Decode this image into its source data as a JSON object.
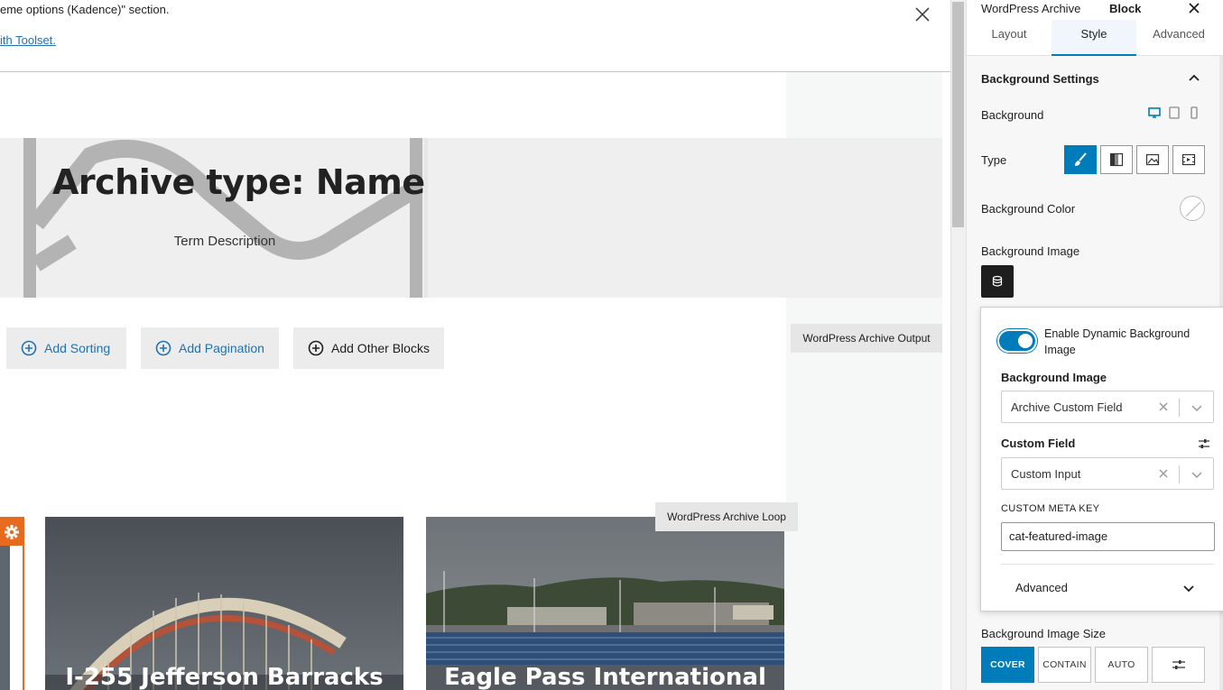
{
  "notice": {
    "text": "eme options (Kadence)\" section.",
    "link": "ith Toolset."
  },
  "hero": {
    "title": "Archive type: Name",
    "description": "Term Description"
  },
  "editor_buttons": {
    "add_sorting": "Add Sorting",
    "add_pagination": "Add Pagination",
    "add_other": "Add Other Blocks"
  },
  "block_labels": {
    "output": "WordPress Archive Output",
    "loop": "WordPress Archive Loop"
  },
  "cards": [
    {
      "title": "I-255 Jefferson Barracks"
    },
    {
      "title": "Eagle Pass International"
    }
  ],
  "sidebar": {
    "tab_document": "WordPress Archive",
    "tab_block": "Block",
    "subtabs": [
      "Layout",
      "Style",
      "Advanced"
    ],
    "active_subtab": "Style",
    "section_title": "Background Settings",
    "background_label": "Background",
    "type_label": "Type",
    "bg_color_label": "Background Color",
    "bg_image_label": "Background Image",
    "popover": {
      "toggle_label": "Enable Dynamic Background Image",
      "toggle_on": true,
      "bg_image_heading": "Background Image",
      "bg_image_value": "Archive Custom Field",
      "custom_field_heading": "Custom Field",
      "custom_field_value": "Custom Input",
      "meta_key_label": "CUSTOM META KEY",
      "meta_key_value": "cat-featured-image",
      "advanced_label": "Advanced"
    },
    "size_label": "Background Image Size",
    "size_options": [
      "COVER",
      "CONTAIN",
      "AUTO"
    ],
    "size_selected": "COVER"
  },
  "colors": {
    "accent": "#007cba",
    "link": "#2271b1",
    "loop_highlight": "#e66b1f"
  }
}
